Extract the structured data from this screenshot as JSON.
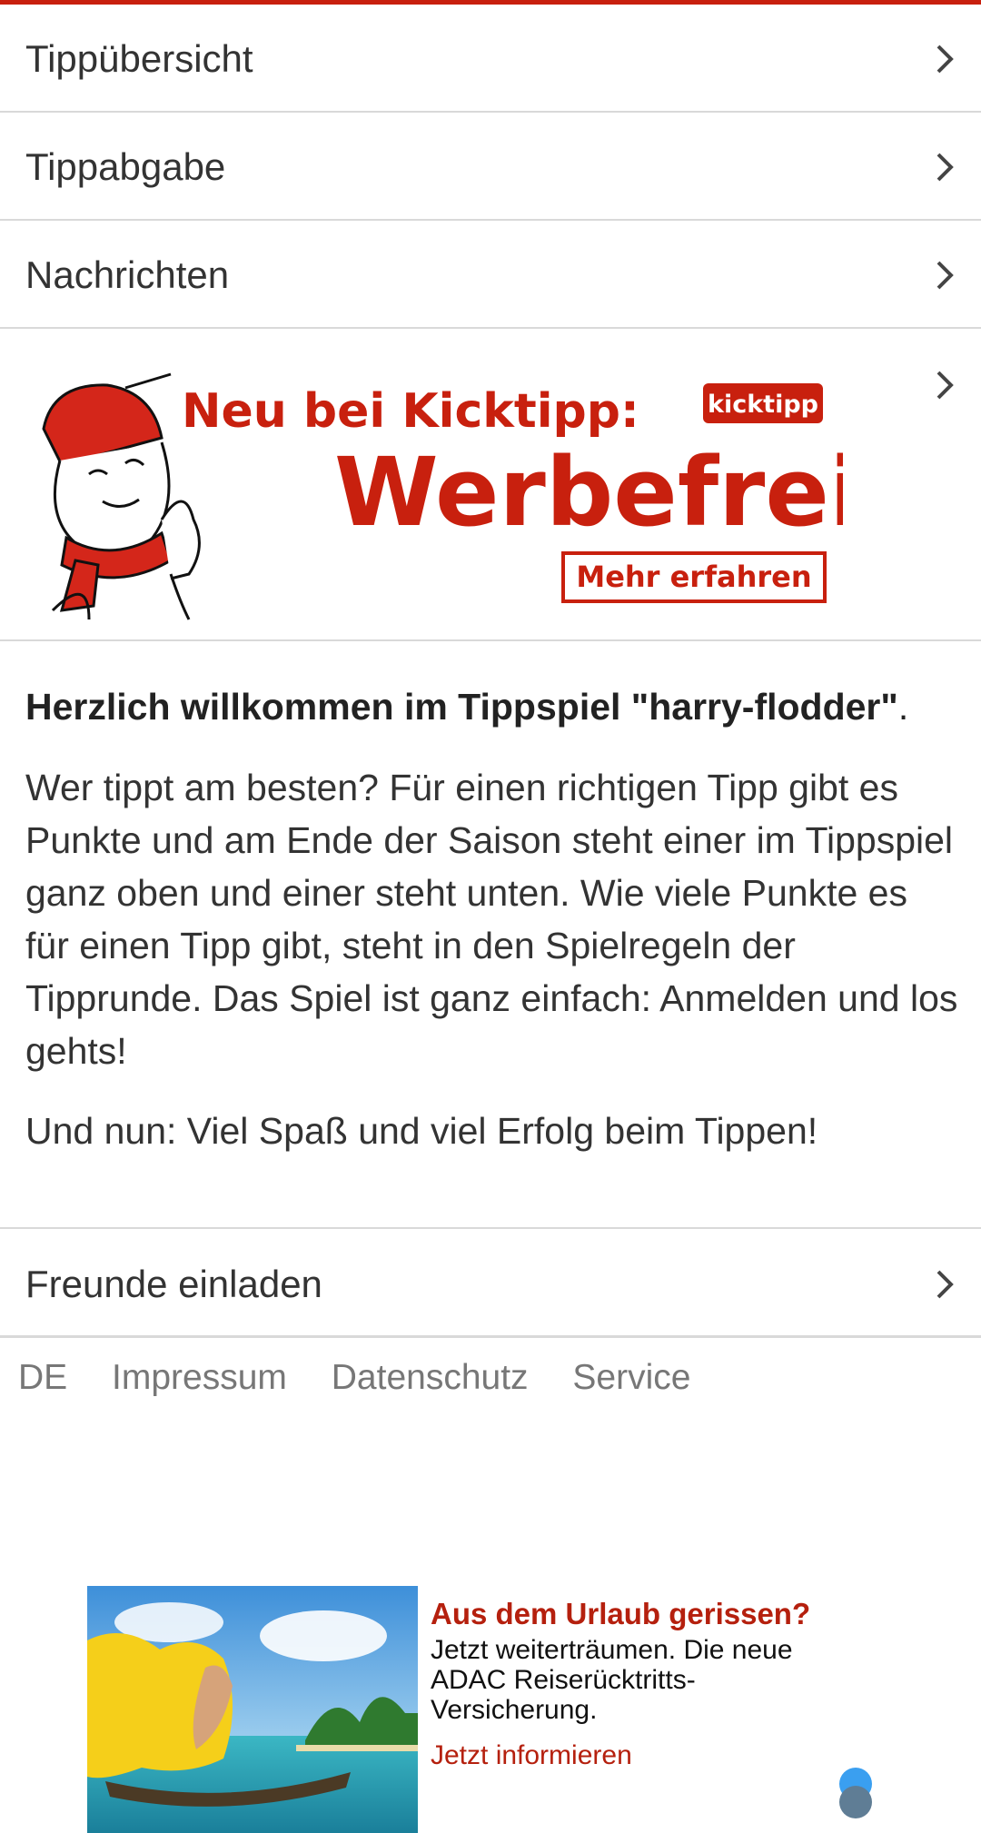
{
  "menu": {
    "items": [
      {
        "label": "Tippübersicht"
      },
      {
        "label": "Tippabgabe"
      },
      {
        "label": "Nachrichten"
      }
    ]
  },
  "promo": {
    "headline": "Neu bei Kicktipp:",
    "brand": "kicktipp",
    "big": "Werbefrei",
    "button": "Mehr erfahren"
  },
  "welcome": {
    "title": "Herzlich willkommen im Tippspiel \"harry-flodder\"",
    "title_end": ".",
    "body": "Wer tippt am besten? Für einen richtigen Tipp gibt es Punkte und am Ende der Saison steht einer im Tippspiel ganz oben und einer steht unten. Wie viele Punkte es für einen Tipp gibt, steht in den Spielregeln der Tipprunde. Das Spiel ist ganz einfach: Anmelden und los gehts!",
    "closing": "Und nun: Viel Spaß und viel Erfolg beim Tippen!"
  },
  "invite": {
    "label": "Freunde einladen"
  },
  "footer": {
    "lang": "DE",
    "links": [
      "Impressum",
      "Datenschutz",
      "Service"
    ]
  },
  "ad": {
    "headline": "Aus dem Urlaub gerissen?",
    "copy_line1": "Jetzt weiterträumen. Die neue",
    "copy_line2": "ADAC Reiserücktritts-",
    "copy_line3": "Versicherung.",
    "cta": "Jetzt informieren"
  },
  "colors": {
    "accent": "#c8200e",
    "divider": "#d9d9d9"
  }
}
